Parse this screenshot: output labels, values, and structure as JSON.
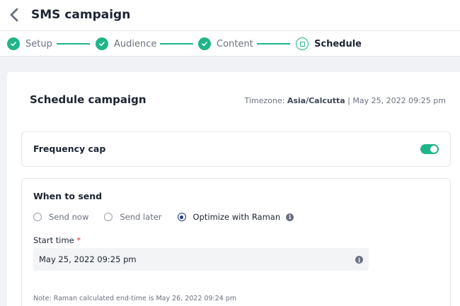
{
  "header": {
    "title": "SMS campaign"
  },
  "stepper": {
    "steps": [
      {
        "label": "Setup",
        "status": "done"
      },
      {
        "label": "Audience",
        "status": "done"
      },
      {
        "label": "Content",
        "status": "done"
      },
      {
        "label": "Schedule",
        "status": "current"
      }
    ]
  },
  "schedule": {
    "title": "Schedule campaign",
    "timezone_label": "Timezone:",
    "timezone_value": "Asia/Calcutta",
    "separator": "|",
    "current_time": "May 25, 2022 09:25 pm"
  },
  "frequency_cap": {
    "label": "Frequency cap",
    "enabled": true
  },
  "when_to_send": {
    "title": "When to send",
    "options": [
      {
        "label": "Send now",
        "selected": false
      },
      {
        "label": "Send later",
        "selected": false
      },
      {
        "label": "Optimize with Raman",
        "selected": true
      }
    ],
    "start_time_label": "Start time",
    "required_mark": "*",
    "start_time_value": "May 25, 2022 09:25 pm",
    "note": "Note: Raman calculated end-time is May 26, 2022 09:24 pm"
  },
  "colors": {
    "accent": "#1fb589",
    "radio_selected": "#1e3a8a",
    "required": "#e53935"
  }
}
